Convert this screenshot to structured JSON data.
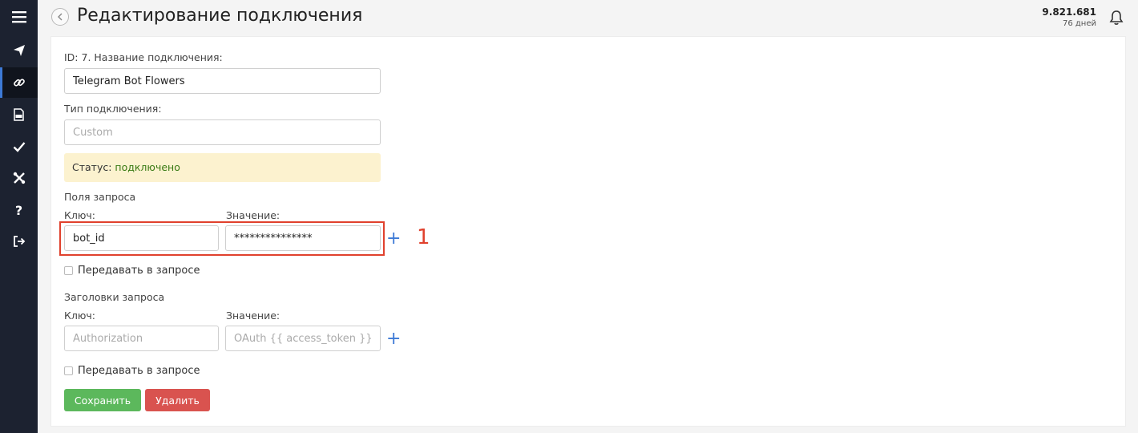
{
  "header": {
    "title": "Редактирование подключения",
    "balance": "9.821.681",
    "days": "76 дней"
  },
  "sidebar": {
    "items": [
      {
        "icon": "menu-icon"
      },
      {
        "icon": "send-icon"
      },
      {
        "icon": "link-icon",
        "active": true
      },
      {
        "icon": "log-icon"
      },
      {
        "icon": "check-icon"
      },
      {
        "icon": "tools-icon"
      },
      {
        "icon": "help-icon"
      },
      {
        "icon": "logout-icon"
      }
    ]
  },
  "form": {
    "name_label": "ID: 7. Название подключения:",
    "name_value": "Telegram Bot Flowers",
    "type_label": "Тип подключения:",
    "type_value": "Custom",
    "status_label": "Статус:",
    "status_value": "подключено",
    "request_fields": {
      "title": "Поля запроса",
      "key_label": "Ключ:",
      "value_label": "Значение:",
      "key_value": "bot_id",
      "value_value": "***************",
      "pass_label": "Передавать в запросе"
    },
    "request_headers": {
      "title": "Заголовки запроса",
      "key_label": "Ключ:",
      "value_label": "Значение:",
      "key_placeholder": "Authorization",
      "value_placeholder": "OAuth {{ access_token }}",
      "pass_label": "Передавать в запросе"
    },
    "save_label": "Сохранить",
    "delete_label": "Удалить"
  },
  "annotation": {
    "number": "1"
  },
  "colors": {
    "sidebar_bg": "#1c2230",
    "accent": "#3d7ad6",
    "save": "#5cb85c",
    "delete": "#d9534f",
    "status_bg": "#fcf2cf",
    "status_ok": "#3a7a14",
    "highlight": "#e0412d"
  }
}
